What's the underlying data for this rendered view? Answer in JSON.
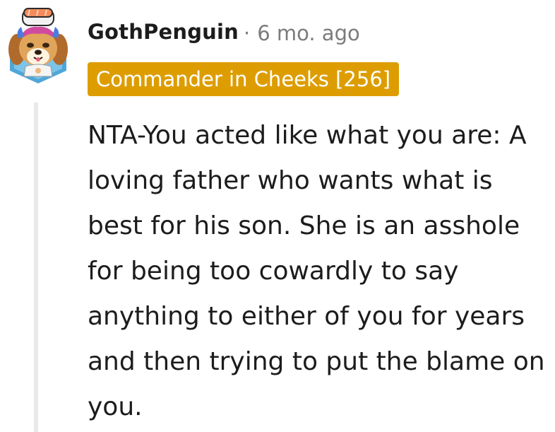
{
  "comment": {
    "author": "GothPenguin",
    "separator": "·",
    "timestamp": "6 mo. ago",
    "flair": "Commander in Cheeks [256]",
    "body": "NTA-You acted like what you are: A loving father who wants what is best for his son. She is an asshole for being too cowardly to say anything to either of you for years and then trying to put the blame on you."
  },
  "colors": {
    "flair_background": "#dd9d00",
    "flair_text": "#ffffff",
    "username": "#1c1c1c",
    "meta": "#7c7c7c",
    "thread_line": "#e9e9e9"
  },
  "icons": {
    "avatar": "dog-avatar-icon"
  }
}
